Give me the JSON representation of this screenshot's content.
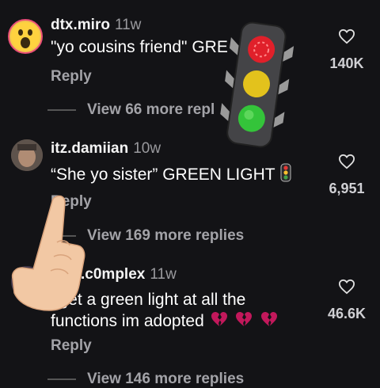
{
  "comments": [
    {
      "username": "dtx.miro",
      "time": "11w",
      "text": "\"yo cousins friend\" GRE",
      "reply_label": "Reply",
      "view_more": "View 66 more repl",
      "likes": "140K",
      "avatar_icon": "shocked-face-avatar"
    },
    {
      "username": "itz.damiian",
      "time": "10w",
      "text": "“She yo sister” GREEN LIGHT",
      "reply_label": "Reply",
      "view_more": "View 169 more replies",
      "likes": "6,951",
      "avatar_icon": "photo-avatar"
    },
    {
      "username": "lena.c0mplex",
      "time": "11w",
      "text_line1": "i get a green light at all the",
      "text_line2": "functions im adopted",
      "reply_label": "Reply",
      "view_more": "View 146 more replies",
      "likes": "46.6K",
      "avatar_icon": "photo-avatar"
    }
  ],
  "stickers": [
    "traffic-light-sticker",
    "pointing-hand-sticker"
  ],
  "colors": {
    "background": "#131316",
    "muted": "#a3a3a8",
    "heart": "#c2185b"
  }
}
